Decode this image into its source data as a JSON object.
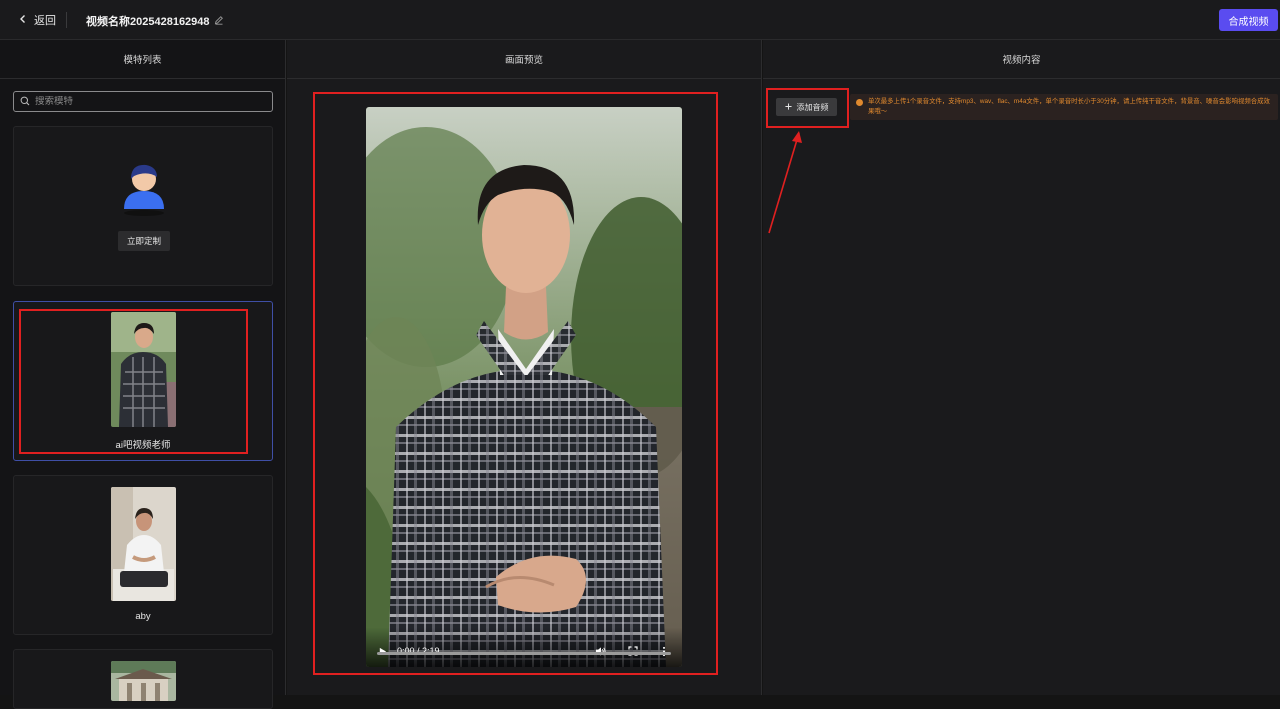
{
  "header": {
    "back_label": "返回",
    "title": "视频名称2025428162948",
    "compose_label": "合成视频",
    "accent_color": "#5a4cf0"
  },
  "left": {
    "heading": "模特列表",
    "search_placeholder": "搜索模特",
    "custom_card": {
      "button_label": "立即定制"
    },
    "models": [
      {
        "name": "ai吧视频老师",
        "selected": true
      },
      {
        "name": "aby",
        "selected": false
      },
      {
        "name": "",
        "selected": false
      }
    ]
  },
  "middle": {
    "heading": "画面预览",
    "video": {
      "time": "0:00 / 2:19",
      "progress": 0
    }
  },
  "right": {
    "heading": "视频内容",
    "add_audio_label": "添加音频",
    "notice_text": "单次最多上传1个录音文件，支持mp3、wav、flac、m4a文件，单个录音时长小于30分钟，请上传纯干音文件，背景音、噪音会影响视频合成效果哦～",
    "notice_color": "#e0892e"
  },
  "annotation_color": "#e02020"
}
